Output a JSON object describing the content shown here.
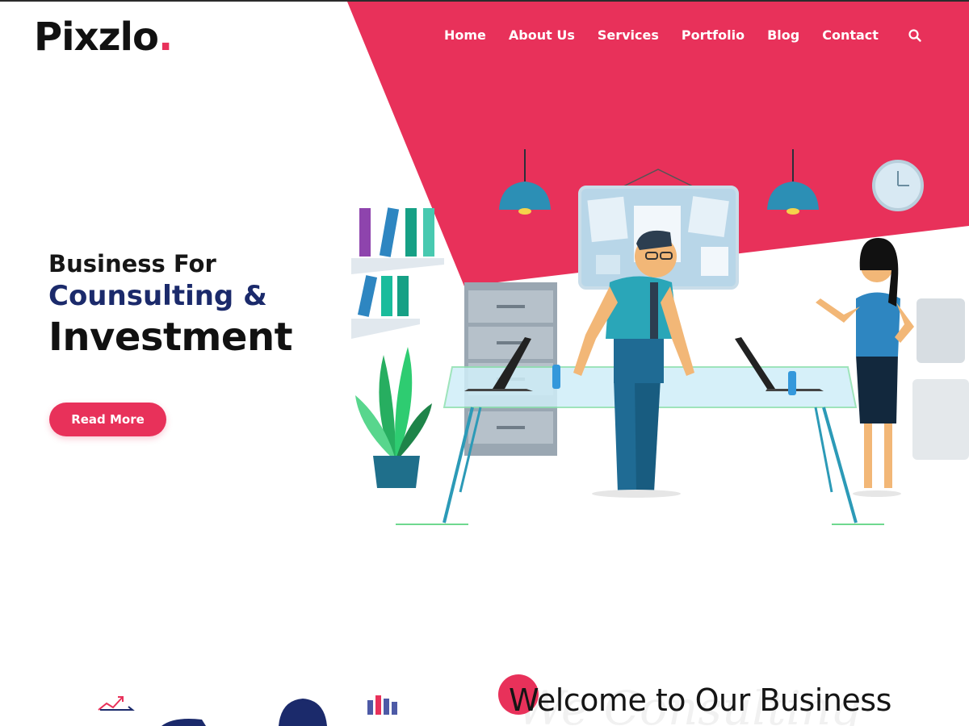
{
  "brand": {
    "name": "Pixzlo",
    "dot": ".",
    "accent_color": "#e8315a"
  },
  "nav": {
    "items": [
      {
        "label": "Home"
      },
      {
        "label": "About Us"
      },
      {
        "label": "Services"
      },
      {
        "label": "Portfolio"
      },
      {
        "label": "Blog"
      },
      {
        "label": "Contact"
      }
    ],
    "search_icon": "search-icon"
  },
  "hero": {
    "line1": "Business For",
    "line2": "Counsulting &",
    "line3": "Investment",
    "cta_label": "Read More",
    "heading_color": "#1b2a6b"
  },
  "illustration": {
    "subject": "office-meeting-illustration"
  },
  "features": {
    "icons": [
      "growth-chart-icon",
      "person-icon",
      "bar-chart-icon"
    ]
  },
  "welcome": {
    "title": "Welcome to Our Business",
    "watermark": "We Consulting"
  }
}
